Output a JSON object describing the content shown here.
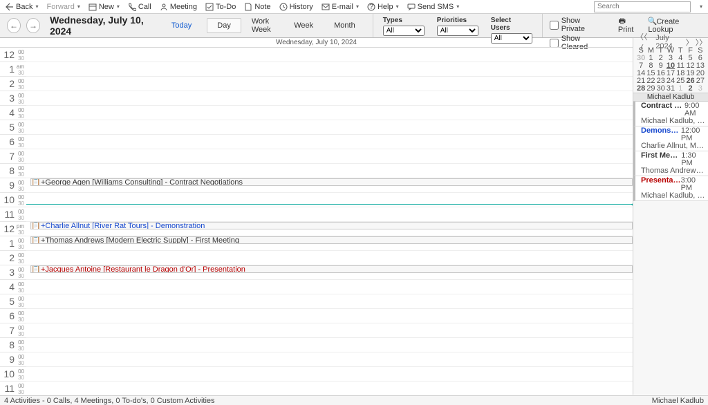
{
  "toolbar": {
    "back": "Back",
    "forward": "Forward",
    "new": "New",
    "call": "Call",
    "meeting": "Meeting",
    "todo": "To-Do",
    "note": "Note",
    "history": "History",
    "email": "E-mail",
    "help": "Help",
    "send_sms": "Send SMS",
    "search_placeholder": "Search"
  },
  "nav": {
    "date_title": "Wednesday, July 10, 2024",
    "today": "Today",
    "views": {
      "day": "Day",
      "workweek": "Work Week",
      "week": "Week",
      "month": "Month"
    },
    "filters": {
      "types": {
        "label": "Types",
        "value": "All"
      },
      "priorities": {
        "label": "Priorities",
        "value": "All"
      },
      "users": {
        "label": "Select Users",
        "value": "All"
      }
    },
    "show_private": "Show Private",
    "show_cleared": "Show Cleared",
    "print": "Print",
    "create_lookup": "Create Lookup"
  },
  "calendar": {
    "header": "Wednesday, July 10, 2024",
    "hours": [
      "12",
      "1",
      "2",
      "3",
      "4",
      "5",
      "6",
      "7",
      "8",
      "9",
      "10",
      "11",
      "12",
      "1",
      "2",
      "3",
      "4",
      "5",
      "6",
      "7",
      "8",
      "9",
      "10",
      "11"
    ],
    "ampm_first": "am",
    "ampm_second": "pm",
    "events": [
      {
        "row": 9,
        "label": "+George Agen [Williams Consulting] - Contract Negotiations",
        "cls": ""
      },
      {
        "row": 12,
        "label": "+Charlie Allnut [River Rat Tours] - Demonstration",
        "cls": "blue"
      },
      {
        "row": 13,
        "label": "+Thomas Andrews [Modern Electric Supply] - First Meeting",
        "cls": ""
      },
      {
        "row": 15,
        "label": "+Jacques Antoine [Restaurant le Dragon d'Or] - Presentation",
        "cls": "red"
      }
    ]
  },
  "mini": {
    "month_title": "July 2024",
    "dow": [
      "S",
      "M",
      "T",
      "W",
      "T",
      "F",
      "S"
    ],
    "weeks": [
      [
        {
          "v": "30",
          "dim": true,
          "bold": true
        },
        {
          "v": "1"
        },
        {
          "v": "2"
        },
        {
          "v": "3"
        },
        {
          "v": "4"
        },
        {
          "v": "5"
        },
        {
          "v": "6"
        }
      ],
      [
        {
          "v": "7"
        },
        {
          "v": "8"
        },
        {
          "v": "9"
        },
        {
          "v": "10",
          "today": true,
          "bold": true
        },
        {
          "v": "11"
        },
        {
          "v": "12"
        },
        {
          "v": "13"
        }
      ],
      [
        {
          "v": "14"
        },
        {
          "v": "15"
        },
        {
          "v": "16"
        },
        {
          "v": "17"
        },
        {
          "v": "18"
        },
        {
          "v": "19"
        },
        {
          "v": "20"
        }
      ],
      [
        {
          "v": "21"
        },
        {
          "v": "22"
        },
        {
          "v": "23"
        },
        {
          "v": "24"
        },
        {
          "v": "25"
        },
        {
          "v": "26",
          "bold": true
        },
        {
          "v": "27"
        }
      ],
      [
        {
          "v": "28",
          "bold": true
        },
        {
          "v": "29"
        },
        {
          "v": "30"
        },
        {
          "v": "31"
        },
        {
          "v": "1",
          "dim": true
        },
        {
          "v": "2",
          "bold": true
        },
        {
          "v": "3",
          "dim": true
        }
      ]
    ]
  },
  "agenda": {
    "header": "Michael Kadlub",
    "items": [
      {
        "title": "Contract Nego...",
        "time": "9:00 AM",
        "who": "Michael Kadlub, George Age...",
        "cls": ""
      },
      {
        "title": "Demonstration",
        "time": "12:00 PM",
        "who": "Charlie Allnut, Michael Kadl...",
        "cls": "blue"
      },
      {
        "title": "First Meeting",
        "time": "1:30 PM",
        "who": "Thomas Andrews, Michael K...",
        "cls": ""
      },
      {
        "title": "Presentation",
        "time": "3:00 PM",
        "who": "Michael Kadlub, Jacques An...",
        "cls": "red"
      }
    ]
  },
  "status": {
    "left": "4 Activities - 0 Calls, 4 Meetings, 0 To-do's, 0 Custom Activities",
    "right": "Michael Kadlub"
  }
}
